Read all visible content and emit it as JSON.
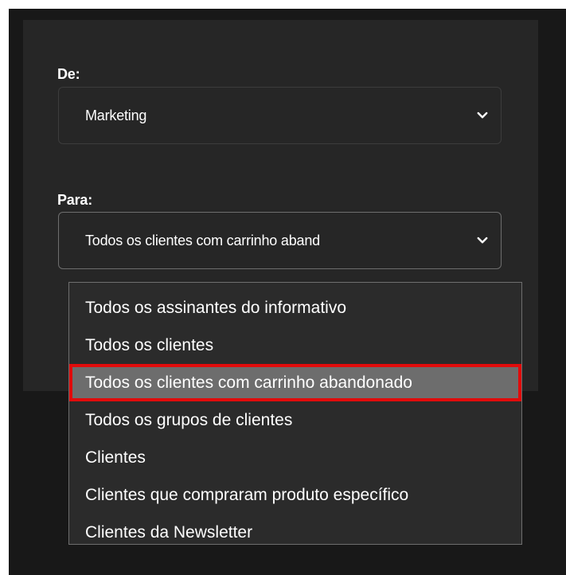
{
  "form": {
    "from_label": "De:",
    "from_value": "Marketing",
    "to_label": "Para:",
    "to_value": "Todos os clientes com carrinho aband"
  },
  "dropdown": {
    "options": [
      "Todos os assinantes do informativo",
      "Todos os clientes",
      "Todos os clientes com carrinho abandonado",
      "Todos os grupos de clientes",
      "Clientes",
      "Clientes que compraram produto específico",
      "Clientes da Newsletter"
    ],
    "highlighted_index": 2
  },
  "colors": {
    "background": "#181818",
    "panel": "#262626",
    "dropdown": "#2b2b2b",
    "highlight": "#6d6d6d",
    "highlight_border": "#e10b0b",
    "text": "#ffffff"
  },
  "icons": {
    "select_arrow": "chevron-down-icon"
  }
}
